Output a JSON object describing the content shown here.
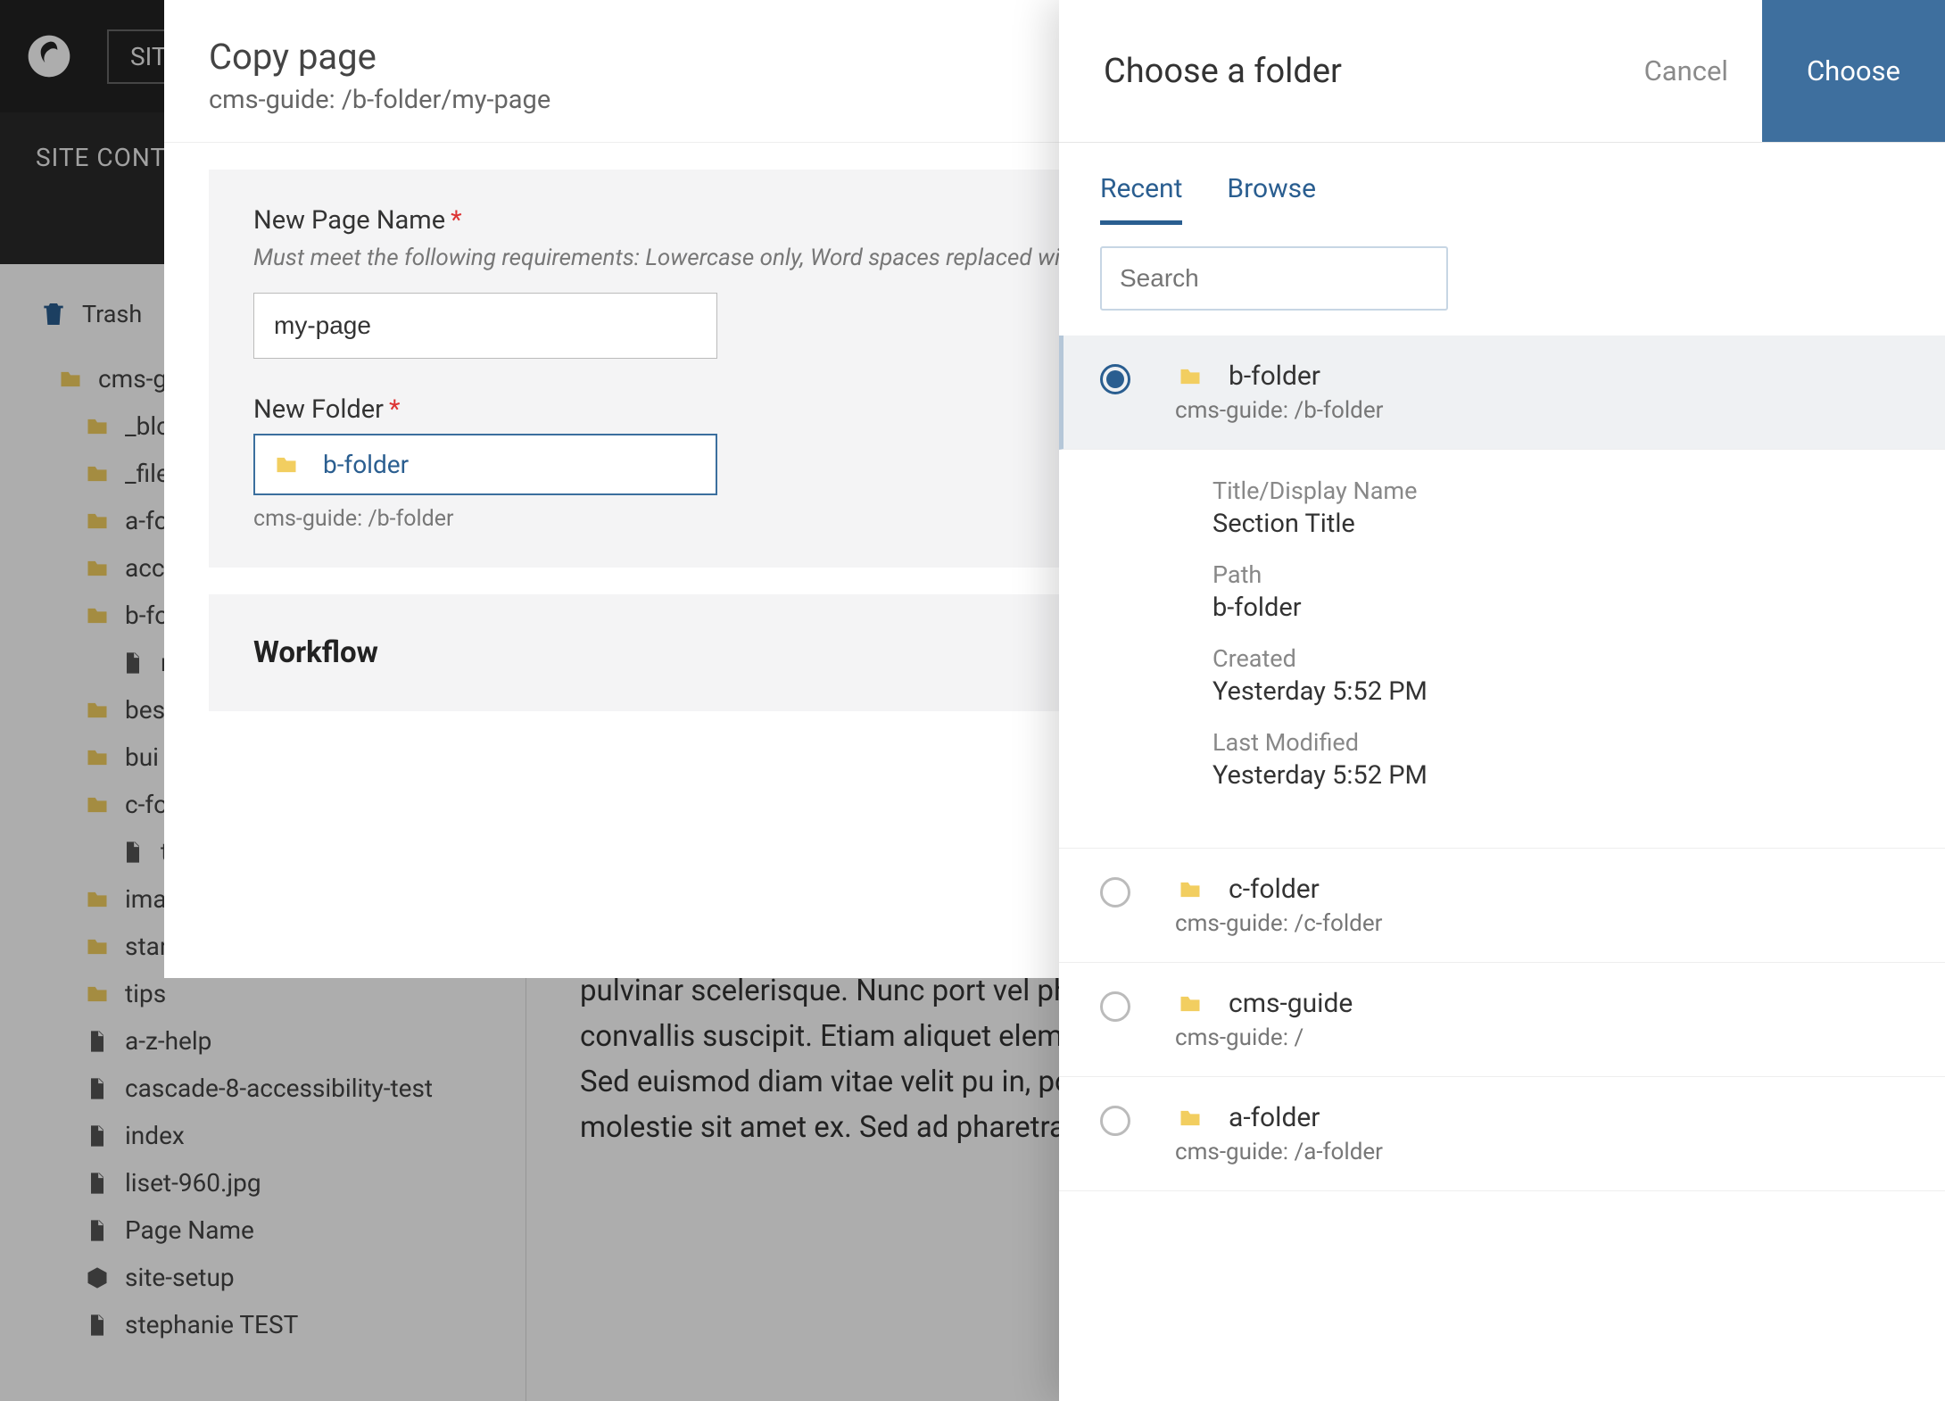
{
  "topbar": {
    "site_label": "SITE:"
  },
  "secondbar": {
    "label": "SITE CONTE"
  },
  "sidebar": {
    "trash_label": "Trash",
    "tree": [
      {
        "name": "cms-g",
        "type": "folder",
        "indent": 0
      },
      {
        "name": "_blo",
        "type": "folder",
        "indent": 1
      },
      {
        "name": "_file",
        "type": "folder",
        "indent": 1
      },
      {
        "name": "a-fo",
        "type": "folder",
        "indent": 1
      },
      {
        "name": "acce",
        "type": "folder",
        "indent": 1
      },
      {
        "name": "b-fo",
        "type": "folder",
        "indent": 1
      },
      {
        "name": "m",
        "type": "file",
        "indent": 2
      },
      {
        "name": "bes",
        "type": "folder",
        "indent": 1
      },
      {
        "name": "bui",
        "type": "folder",
        "indent": 1
      },
      {
        "name": "c-fo",
        "type": "folder",
        "indent": 1
      },
      {
        "name": "te",
        "type": "file",
        "indent": 2
      },
      {
        "name": "ima",
        "type": "folder",
        "indent": 1
      },
      {
        "name": "start",
        "type": "folder",
        "indent": 1
      },
      {
        "name": "tips",
        "type": "folder",
        "indent": 1
      },
      {
        "name": "a-z-help",
        "type": "file",
        "indent": 1
      },
      {
        "name": "cascade-8-accessibility-test",
        "type": "file",
        "indent": 1
      },
      {
        "name": "index",
        "type": "file",
        "indent": 1
      },
      {
        "name": "liset-960.jpg",
        "type": "file",
        "indent": 1
      },
      {
        "name": "Page Name",
        "type": "file",
        "indent": 1
      },
      {
        "name": "site-setup",
        "type": "box",
        "indent": 1
      },
      {
        "name": "stephanie TEST",
        "type": "file",
        "indent": 1
      }
    ]
  },
  "content_text": "pulvinar scelerisque. Nunc port vel pharetra. Fusce nulla quam, convallis suscipit. Etiam aliquet elementum lectus diam vel mag Sed euismod diam vitae velit pu in, posuere posuere orci. Donec sed, molestie sit amet ex. Sed ad pharetra porttitor elementum. S",
  "copy_modal": {
    "title": "Copy page",
    "path": "cms-guide: /b-folder/my-page",
    "name_label": "New Page Name",
    "name_help": "Must meet the following requirements: Lowercase only, Word spaces replaced with hy",
    "name_value": "my-page",
    "folder_label": "New Folder",
    "folder_name": "b-folder",
    "folder_path": "cms-guide: /b-folder",
    "workflow_title": "Workflow"
  },
  "panel": {
    "title": "Choose a folder",
    "cancel": "Cancel",
    "choose": "Choose",
    "tabs": {
      "recent": "Recent",
      "browse": "Browse"
    },
    "search_placeholder": "Search",
    "items": [
      {
        "name": "b-folder",
        "path": "cms-guide: /b-folder",
        "selected": true
      },
      {
        "name": "c-folder",
        "path": "cms-guide: /c-folder",
        "selected": false
      },
      {
        "name": "cms-guide",
        "path": "cms-guide: /",
        "selected": false
      },
      {
        "name": "a-folder",
        "path": "cms-guide: /a-folder",
        "selected": false
      }
    ],
    "details": {
      "title_label": "Title/Display Name",
      "title_value": "Section Title",
      "path_label": "Path",
      "path_value": "b-folder",
      "created_label": "Created",
      "created_value": "Yesterday 5:52 PM",
      "modified_label": "Last Modified",
      "modified_value": "Yesterday 5:52 PM"
    }
  }
}
